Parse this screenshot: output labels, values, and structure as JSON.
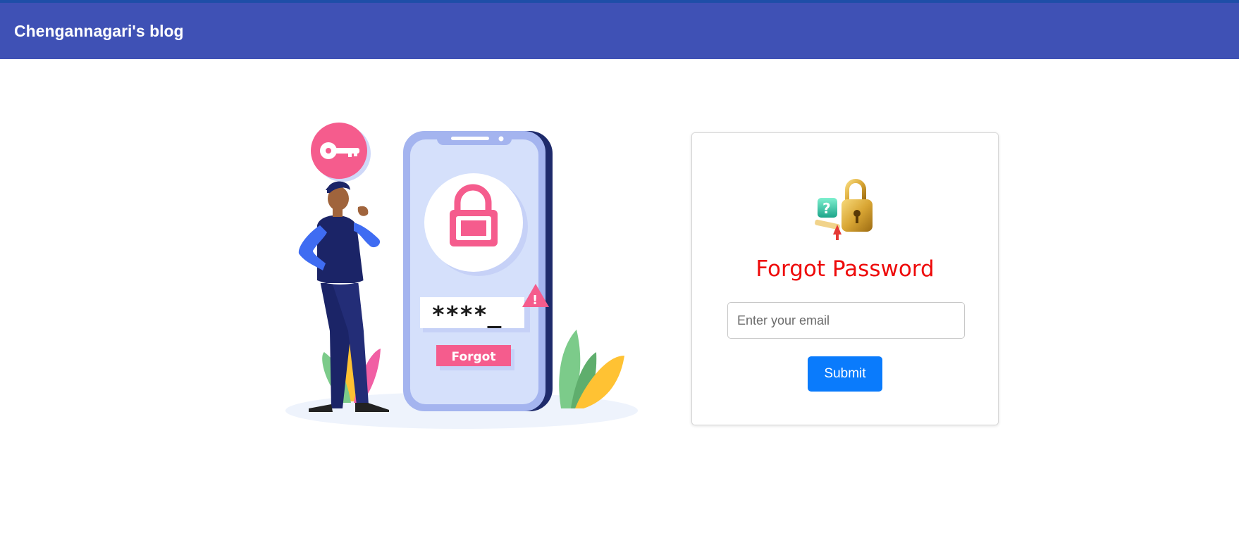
{
  "navbar": {
    "brand": "Chengannagari's blog",
    "color": "#3f51b5"
  },
  "illustration": {
    "masked_password": "****_",
    "forgot_label": "Forgot",
    "warning_glyph": "!",
    "icons": [
      "key-icon",
      "lock-icon",
      "warning-icon"
    ]
  },
  "form": {
    "title": "Forgot Password",
    "title_color": "#ee0a0a",
    "email_placeholder": "Enter your email",
    "email_value": "",
    "submit_label": "Submit",
    "submit_color": "#0a7bfc"
  }
}
